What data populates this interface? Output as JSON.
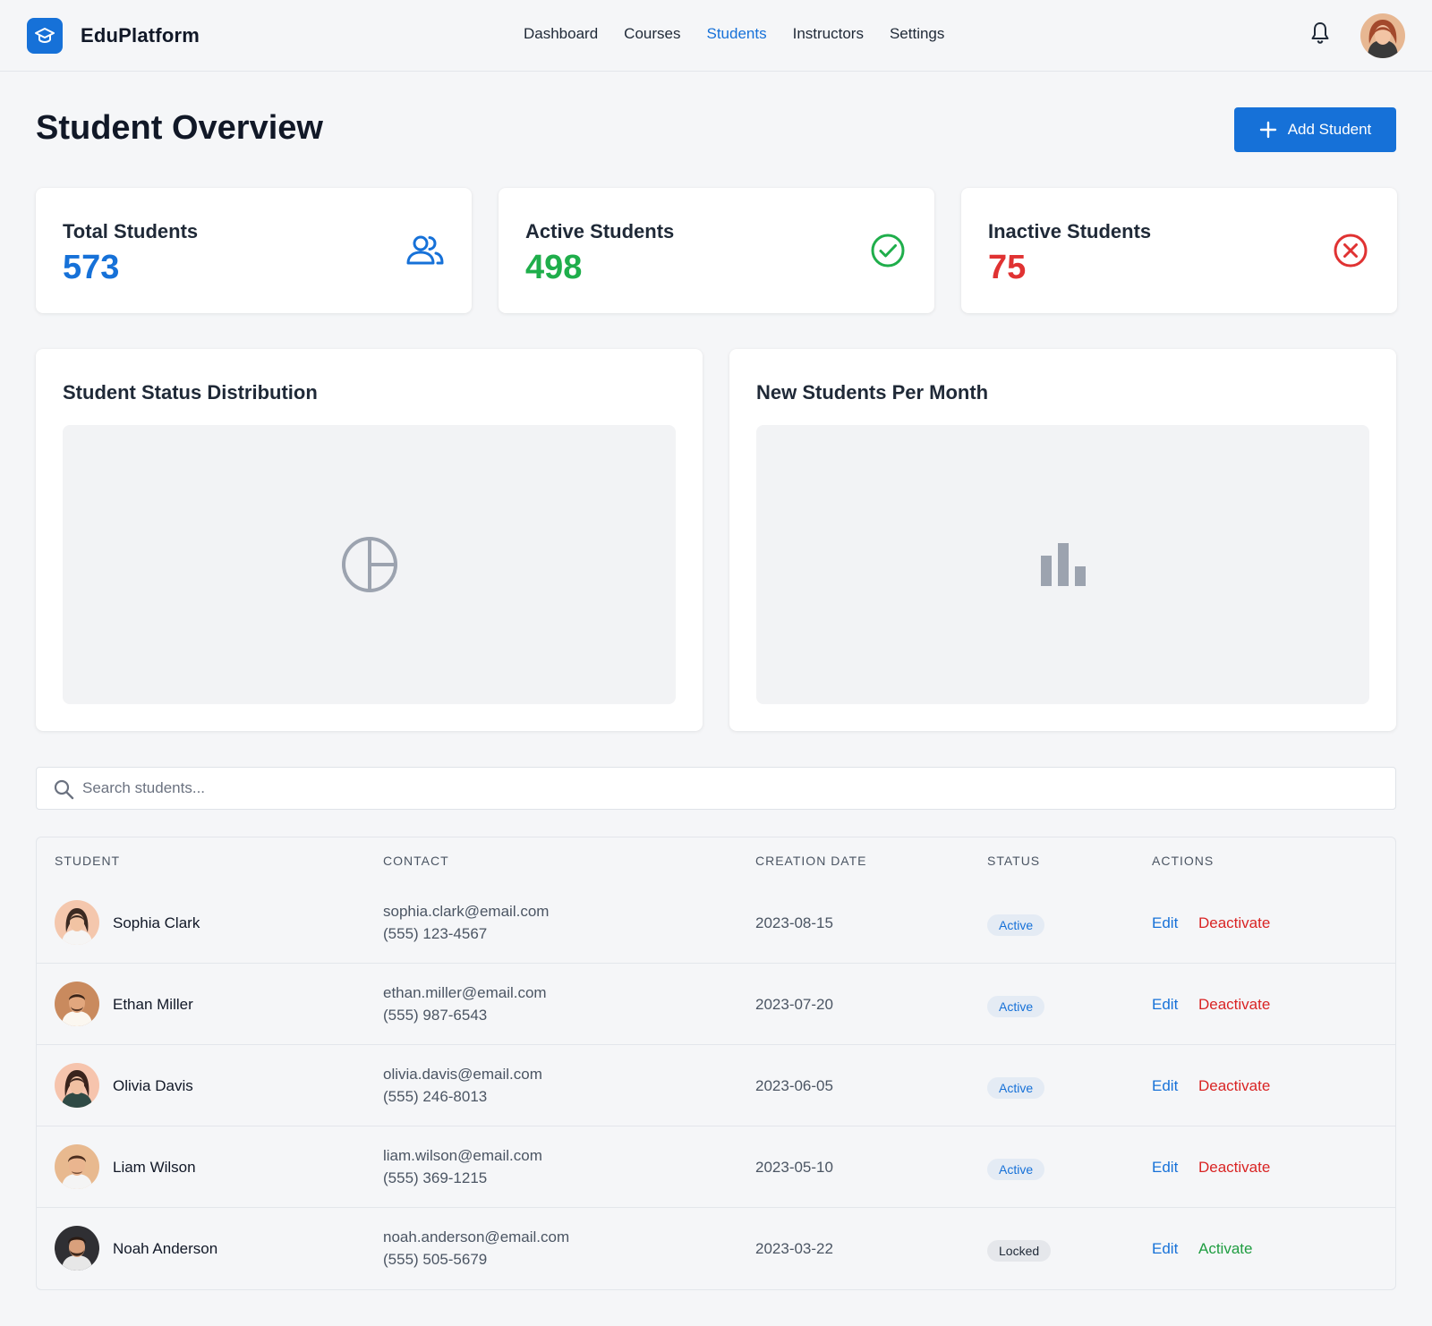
{
  "header": {
    "brand": "EduPlatform",
    "nav": [
      {
        "label": "Dashboard",
        "active": false
      },
      {
        "label": "Courses",
        "active": false
      },
      {
        "label": "Students",
        "active": true
      },
      {
        "label": "Instructors",
        "active": false
      },
      {
        "label": "Settings",
        "active": false
      }
    ],
    "icons": {
      "logo": "graduation-cap-icon",
      "notifications": "bell-icon",
      "avatar": "user-avatar"
    }
  },
  "page": {
    "title": "Student Overview",
    "add_button_label": "Add Student",
    "add_button_icon": "plus-icon"
  },
  "stats": [
    {
      "label": "Total Students",
      "value": "573",
      "color": "#1671d8",
      "icon": "users-icon"
    },
    {
      "label": "Active Students",
      "value": "498",
      "color": "#1fae4b",
      "icon": "check-circle-icon"
    },
    {
      "label": "Inactive Students",
      "value": "75",
      "color": "#e03232",
      "icon": "x-circle-icon"
    }
  ],
  "charts": {
    "status_distribution": {
      "title": "Student Status Distribution",
      "icon": "pie-chart-icon"
    },
    "new_per_month": {
      "title": "New Students Per Month",
      "icon": "bar-chart-icon"
    }
  },
  "search": {
    "placeholder": "Search students...",
    "value": "",
    "icon": "search-icon"
  },
  "table": {
    "columns": [
      "Student",
      "Contact",
      "Creation Date",
      "Status",
      "Actions"
    ],
    "rows": [
      {
        "name": "Sophia Clark",
        "email": "sophia.clark@email.com",
        "phone": "(555) 123-4567",
        "date": "2023-08-15",
        "status": "Active",
        "edit": "Edit",
        "action": "Deactivate"
      },
      {
        "name": "Ethan Miller",
        "email": "ethan.miller@email.com",
        "phone": "(555) 987-6543",
        "date": "2023-07-20",
        "status": "Active",
        "edit": "Edit",
        "action": "Deactivate"
      },
      {
        "name": "Olivia Davis",
        "email": "olivia.davis@email.com",
        "phone": "(555) 246-8013",
        "date": "2023-06-05",
        "status": "Active",
        "edit": "Edit",
        "action": "Deactivate"
      },
      {
        "name": "Liam Wilson",
        "email": "liam.wilson@email.com",
        "phone": "(555) 369-1215",
        "date": "2023-05-10",
        "status": "Active",
        "edit": "Edit",
        "action": "Deactivate"
      },
      {
        "name": "Noah Anderson",
        "email": "noah.anderson@email.com",
        "phone": "(555) 505-5679",
        "date": "2023-03-22",
        "status": "Locked",
        "edit": "Edit",
        "action": "Activate"
      }
    ]
  },
  "colors": {
    "primary": "#1671d8",
    "danger": "#d92424",
    "success": "#1f9d41",
    "background": "#f5f6f8"
  }
}
